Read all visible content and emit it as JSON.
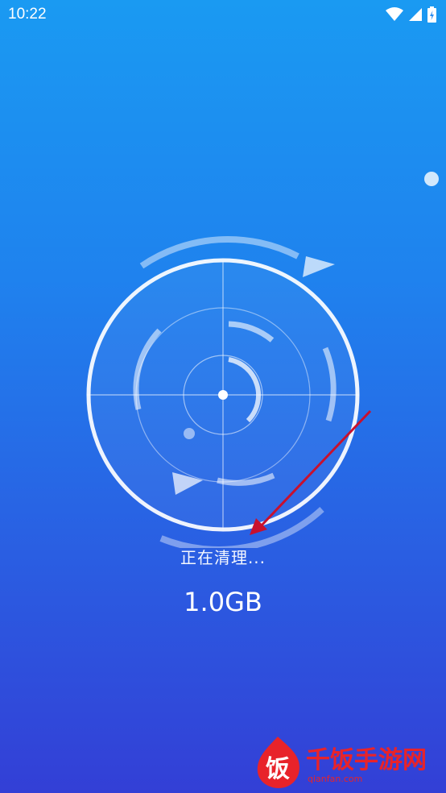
{
  "status_bar": {
    "time": "10:22",
    "icons": [
      "wifi-icon",
      "signal-icon",
      "battery-charging-icon"
    ]
  },
  "scanner": {
    "icon": "radar-scan-icon"
  },
  "cleaning": {
    "status_text": "正在清理...",
    "size_value": "1.0GB"
  },
  "overlay": {
    "annotation": "red-arrow-icon"
  },
  "watermark": {
    "name": "千饭手游网",
    "site": "qianfan.com",
    "logo_char": "饭",
    "color": "#e8232a"
  },
  "colors": {
    "background_top": "#1a9af2",
    "background_bottom": "#333fd6",
    "arrow": "#c8102e"
  }
}
